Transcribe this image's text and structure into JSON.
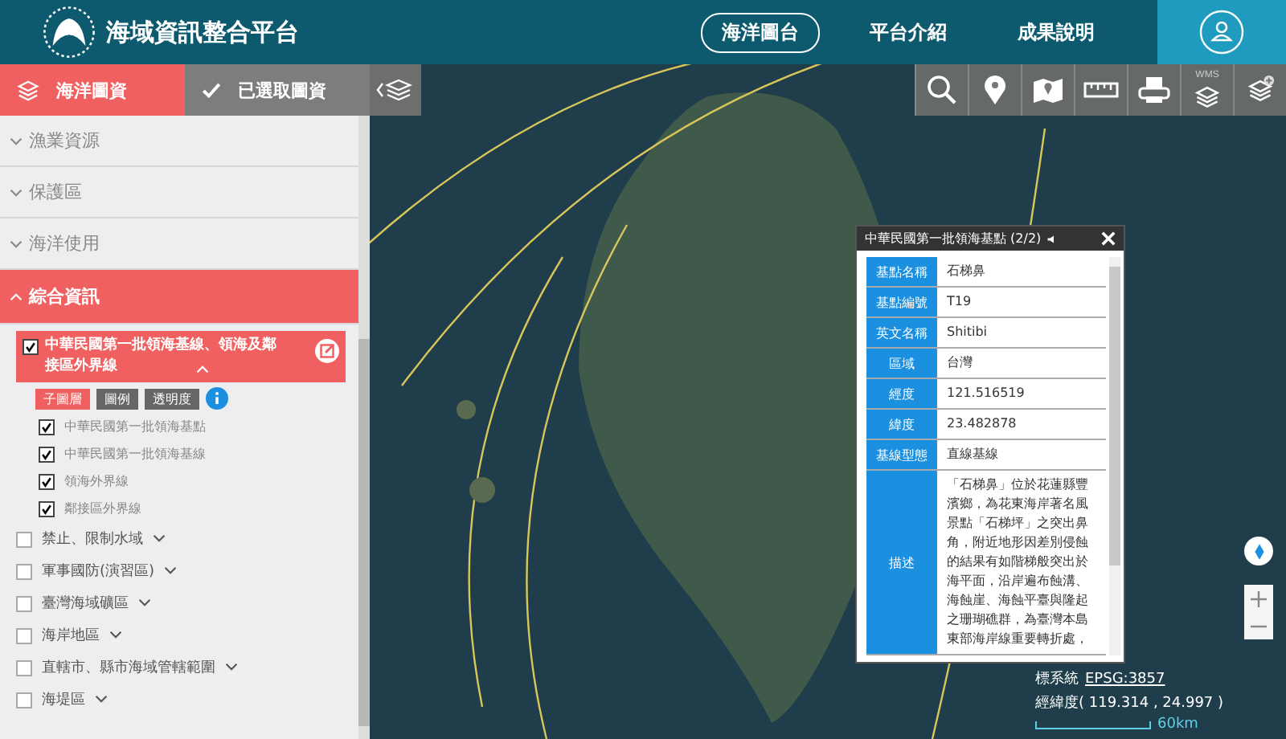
{
  "header": {
    "title": "海域資訊整合平台",
    "nav": [
      {
        "label": "海洋圖台",
        "selected": true
      },
      {
        "label": "平台介紹",
        "selected": false
      },
      {
        "label": "成果說明",
        "selected": false
      }
    ]
  },
  "sidebar": {
    "tabs": [
      {
        "label": "海洋圖資",
        "selected": true,
        "kind": "layers"
      },
      {
        "label": "已選取圖資",
        "selected": false,
        "kind": "check"
      }
    ],
    "categories": [
      {
        "label": "漁業資源",
        "expanded": false
      },
      {
        "label": "保護區",
        "expanded": false
      },
      {
        "label": "海洋使用",
        "expanded": false
      },
      {
        "label": "綜合資訊",
        "expanded": true,
        "layers": [
          {
            "label": "中華民國第一批領海基線、領海及鄰接區外界線",
            "checked": true,
            "expanded": true,
            "buttons": [
              {
                "label": "子圖層",
                "selected": true
              },
              {
                "label": "圖例",
                "selected": false
              },
              {
                "label": "透明度",
                "selected": false
              }
            ],
            "sublayers": [
              {
                "label": "中華民國第一批領海基點",
                "checked": true
              },
              {
                "label": "中華民國第一批領海基線",
                "checked": true
              },
              {
                "label": "領海外界線",
                "checked": true
              },
              {
                "label": "鄰接區外界線",
                "checked": true
              }
            ]
          },
          {
            "label": "禁止、限制水域",
            "checked": false,
            "expanded": false
          },
          {
            "label": "軍事國防(演習區)",
            "checked": false,
            "expanded": false
          },
          {
            "label": "臺灣海域礦區",
            "checked": false,
            "expanded": false
          },
          {
            "label": "海岸地區",
            "checked": false,
            "expanded": false
          },
          {
            "label": "直轄市、縣市海域管轄範圍",
            "checked": false,
            "expanded": false
          },
          {
            "label": "海堤區",
            "checked": false,
            "expanded": false
          }
        ]
      }
    ]
  },
  "toolbar": [
    {
      "kind": "search"
    },
    {
      "kind": "pin"
    },
    {
      "kind": "map"
    },
    {
      "kind": "ruler"
    },
    {
      "kind": "print"
    },
    {
      "kind": "wms",
      "label": "WMS"
    },
    {
      "kind": "add-layer"
    }
  ],
  "popup": {
    "title": "中華民國第一批領海基點 (2/2)",
    "fields": [
      {
        "label": "基點名稱",
        "value": "石梯鼻"
      },
      {
        "label": "基點編號",
        "value": "T19"
      },
      {
        "label": "英文名稱",
        "value": "Shitibi"
      },
      {
        "label": "區域",
        "value": "台灣"
      },
      {
        "label": "經度",
        "value": "121.516519"
      },
      {
        "label": "緯度",
        "value": "23.482878"
      },
      {
        "label": "基線型態",
        "value": "直線基線"
      },
      {
        "label": "描述",
        "value": "「石梯鼻」位於花蓮縣豐濱鄉，為花東海岸著名風景點「石梯坪」之突出鼻角，附近地形因差別侵蝕的結果有如階梯般突出於海平面，沿岸遍布蝕溝、海蝕崖、海蝕平臺與隆起之珊瑚礁群，為臺灣本島東部海岸線重要轉折處，"
      }
    ]
  },
  "map_info": {
    "crs_label": "標系統",
    "crs_link": "EPSG:3857",
    "lonlat": "經緯度( 119.314 , 24.997 )",
    "scale": "60km"
  }
}
